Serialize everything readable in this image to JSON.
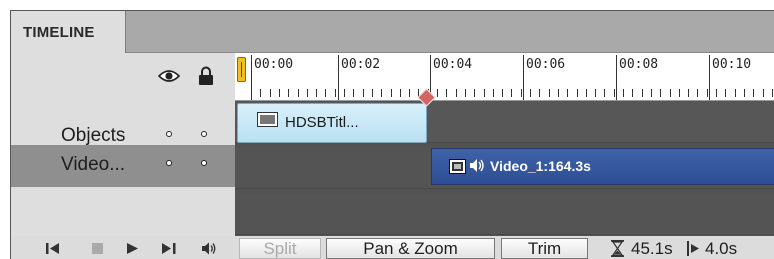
{
  "header": {
    "tab_label": "TIMELINE"
  },
  "ruler": {
    "labels": [
      "00:00",
      "00:02",
      "00:04",
      "00:06",
      "00:08",
      "00:10"
    ]
  },
  "tracks": [
    {
      "label": "Objects"
    },
    {
      "label": "Video..."
    }
  ],
  "clips": {
    "title_clip": {
      "label": "HDSBTitl..."
    },
    "video_clip": {
      "label": "Video_1:164.3s"
    }
  },
  "controls": {
    "split": "Split",
    "pan_zoom": "Pan & Zoom",
    "trim": "Trim",
    "duration": "45.1s",
    "position": "4.0s"
  },
  "icons": {
    "visibility": "eye-icon",
    "lock": "lock-icon",
    "go_start": "skip-to-start-icon",
    "stop": "stop-icon",
    "play": "play-icon",
    "go_end": "skip-to-end-icon",
    "volume": "speaker-icon",
    "hourglass": "hourglass-icon",
    "playhead_position": "playhead-position-icon"
  },
  "colors": {
    "title_clip": "#c7e8f7",
    "video_clip": "#3558a0",
    "marker": "#d76464",
    "playhead": "#f0c020"
  }
}
